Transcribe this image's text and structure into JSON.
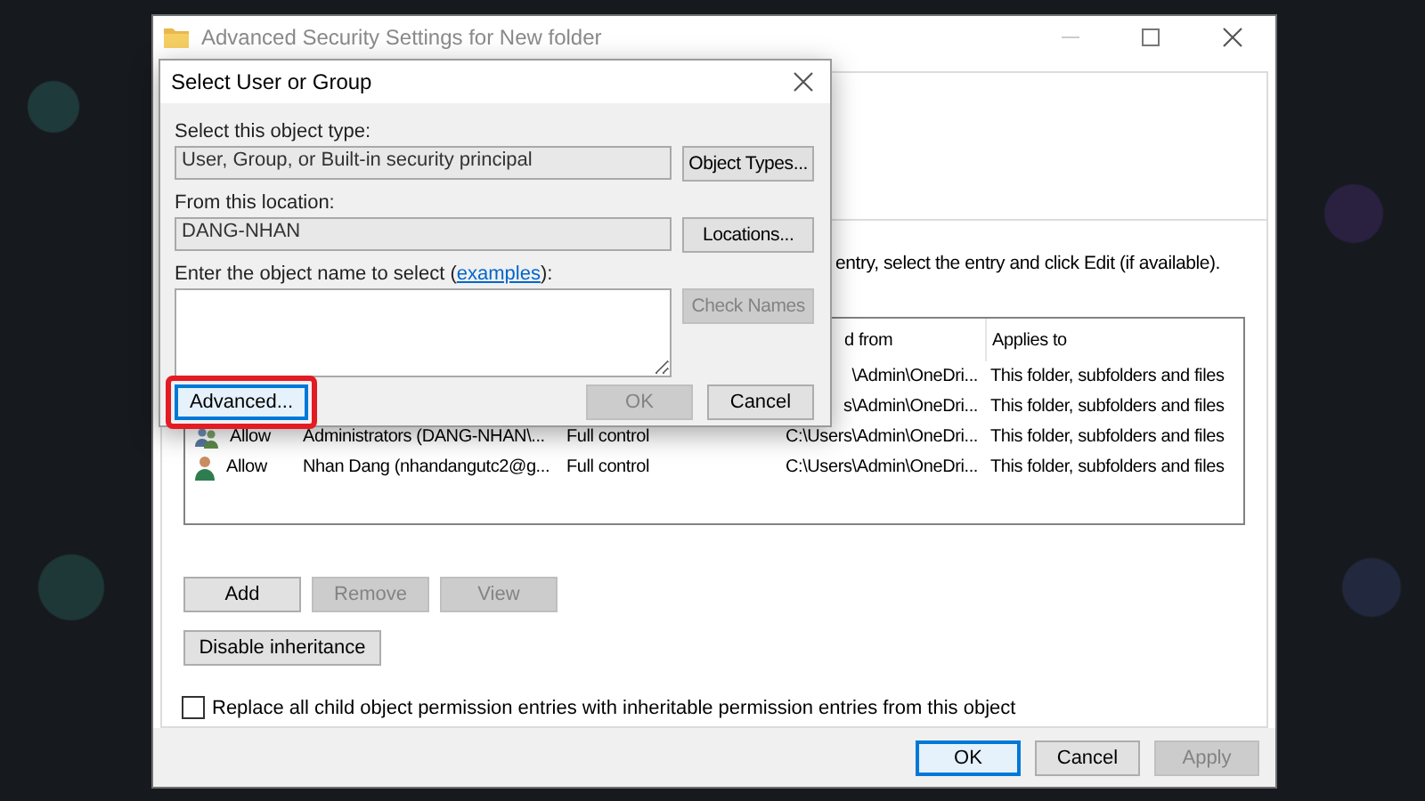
{
  "window": {
    "title": "Advanced Security Settings for New folder"
  },
  "instruction": "entry, select the entry and click Edit (if available).",
  "permissions": {
    "columns": [
      "d from",
      "Applies to"
    ],
    "rows": [
      {
        "inherited_from": "\\Admin\\OneDri...",
        "applies_to": "This folder, subfolders and files"
      },
      {
        "inherited_from": "s\\Admin\\OneDri...",
        "applies_to": "This folder, subfolders and files"
      },
      {
        "kind": "group",
        "type": "Allow",
        "principal": "Administrators (DANG-NHAN\\...",
        "access": "Full control",
        "inherited_from": "C:\\Users\\Admin\\OneDri...",
        "applies_to": "This folder, subfolders and files"
      },
      {
        "kind": "user",
        "type": "Allow",
        "principal": "Nhan Dang (nhandangutc2@g...",
        "access": "Full control",
        "inherited_from": "C:\\Users\\Admin\\OneDri...",
        "applies_to": "This folder, subfolders and files"
      }
    ]
  },
  "entry_buttons": [
    {
      "label": "Add",
      "disabled": false
    },
    {
      "label": "Remove",
      "disabled": true
    },
    {
      "label": "View",
      "disabled": true
    }
  ],
  "inheritance_button": "Disable inheritance",
  "replace_checkbox": {
    "label": "Replace all child object permission entries with inheritable permission entries from this object",
    "checked": false
  },
  "footer_buttons": [
    {
      "label": "OK",
      "disabled": false,
      "focused": true
    },
    {
      "label": "Cancel",
      "disabled": false,
      "focused": false
    },
    {
      "label": "Apply",
      "disabled": true,
      "focused": false
    }
  ],
  "dialog": {
    "title": "Select User or Group",
    "object_type": {
      "label": "Select this object type:",
      "value": "User, Group, or Built-in security principal",
      "button": "Object Types..."
    },
    "location": {
      "label": "From this location:",
      "value": "DANG-NHAN",
      "button": "Locations..."
    },
    "object_name": {
      "label_before": "Enter the object name to select (",
      "link": "examples",
      "label_after": "):",
      "button": "Check Names",
      "button_disabled": true
    },
    "buttons": [
      {
        "label": "Advanced...",
        "disabled": false,
        "highlighted": true
      },
      {
        "label": "OK",
        "disabled": true,
        "highlighted": false
      },
      {
        "label": "Cancel",
        "disabled": false,
        "highlighted": false
      }
    ]
  }
}
